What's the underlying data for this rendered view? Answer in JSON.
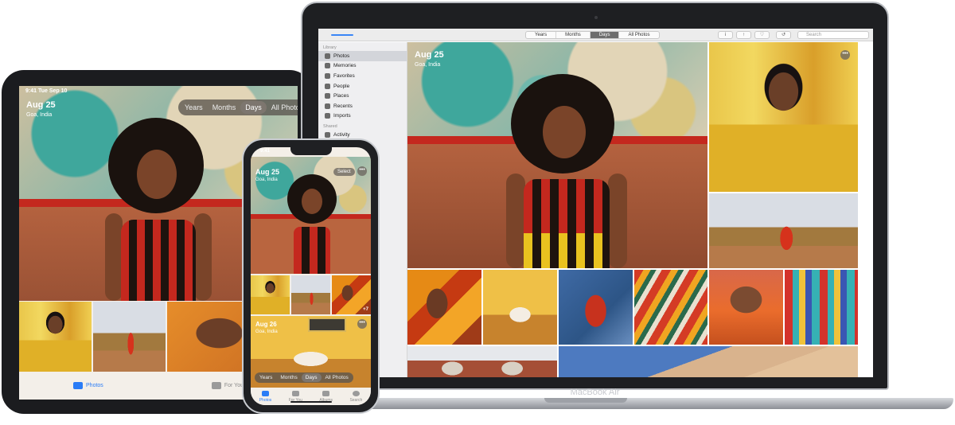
{
  "ipad": {
    "status_time": "9:41 Tue Sep 10",
    "photo_date": "Aug 25",
    "photo_place": "Goa, India",
    "segments": [
      "Years",
      "Months",
      "Days",
      "All Photos"
    ],
    "active_segment": "Days",
    "tabs": [
      {
        "label": "Photos",
        "icon": "photos-icon",
        "active": true
      },
      {
        "label": "For You",
        "icon": "for-you-icon",
        "active": false
      }
    ]
  },
  "iphone": {
    "status_time": "9:41",
    "select_label": "Select",
    "more_label": "•••",
    "group1_date": "Aug 25",
    "group1_place": "Goa, India",
    "extra_count": "+7",
    "group2_date": "Aug 26",
    "group2_place": "Goa, India",
    "segments": [
      "Years",
      "Months",
      "Days",
      "All Photos"
    ],
    "active_segment": "Days",
    "tabs": [
      {
        "label": "Photos",
        "icon": "photos-icon",
        "active": true
      },
      {
        "label": "For You",
        "icon": "for-you-icon",
        "active": false
      },
      {
        "label": "Albums",
        "icon": "albums-icon",
        "active": false
      },
      {
        "label": "Search",
        "icon": "search-icon",
        "active": false
      }
    ]
  },
  "mac": {
    "brand": "MacBook Air",
    "segments": [
      "Years",
      "Months",
      "Days",
      "All Photos"
    ],
    "active_segment": "Days",
    "search_placeholder": "Search",
    "photo_date": "Aug 25",
    "photo_place": "Goa, India",
    "more_label": "•••",
    "sidebar": {
      "library_heading": "Library",
      "library_items": [
        {
          "label": "Photos",
          "icon": "photos-icon",
          "active": true
        },
        {
          "label": "Memories",
          "icon": "memories-icon",
          "active": false
        },
        {
          "label": "Favorites",
          "icon": "heart-icon",
          "active": false
        },
        {
          "label": "People",
          "icon": "person-icon",
          "active": false
        },
        {
          "label": "Places",
          "icon": "pin-icon",
          "active": false
        },
        {
          "label": "Recents",
          "icon": "clock-icon",
          "active": false
        },
        {
          "label": "Imports",
          "icon": "import-icon",
          "active": false
        }
      ],
      "shared_heading": "Shared",
      "shared_items": [
        {
          "label": "Activity",
          "icon": "cloud-icon",
          "active": false
        }
      ]
    }
  },
  "colors": {
    "accent": "#2a7cf6",
    "segment_active": "#6d6d6d"
  }
}
